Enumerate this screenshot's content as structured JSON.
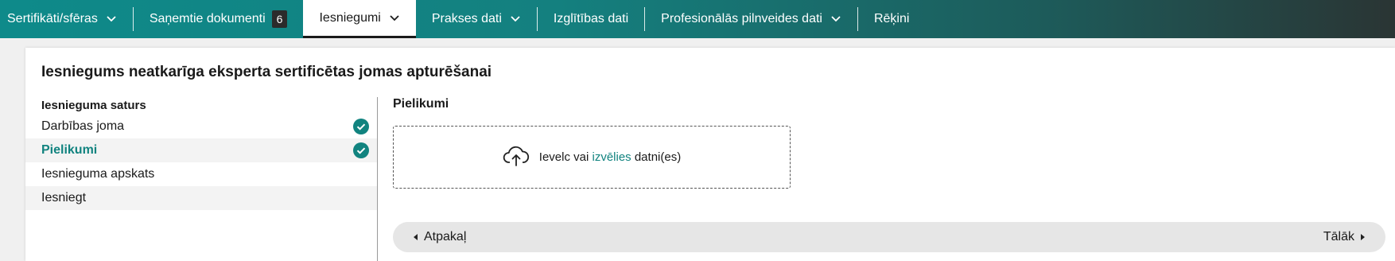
{
  "nav": {
    "items": [
      {
        "label": "Sertifikāti/sfēras",
        "has_dropdown": true
      },
      {
        "label": "Saņemtie dokumenti",
        "badge": "6"
      },
      {
        "label": "Iesniegumi",
        "has_dropdown": true,
        "active": true
      },
      {
        "label": "Prakses dati",
        "has_dropdown": true
      },
      {
        "label": "Izglītības dati"
      },
      {
        "label": "Profesionālās pilnveides dati",
        "has_dropdown": true
      },
      {
        "label": "Rēķini"
      }
    ],
    "gradient_start": "#0e8a8a",
    "gradient_end": "#2a3534"
  },
  "page": {
    "title": "Iesniegums neatkarīga eksperta sertificētas jomas apturēšanai"
  },
  "steps": {
    "heading": "Iesnieguma saturs",
    "items": [
      {
        "label": "Darbības joma",
        "completed": true
      },
      {
        "label": "Pielikumi",
        "completed": true,
        "active": true
      },
      {
        "label": "Iesnieguma apskats"
      },
      {
        "label": "Iesniegt"
      }
    ]
  },
  "attachments": {
    "title": "Pielikumi",
    "drop_prefix": "Ievelc vai",
    "drop_link": "izvēlies",
    "drop_suffix": "datni(es)",
    "icon": "cloud-upload-icon"
  },
  "pager": {
    "back_label": "Atpakaļ",
    "next_label": "Tālāk"
  },
  "colors": {
    "accent": "#11837f"
  }
}
